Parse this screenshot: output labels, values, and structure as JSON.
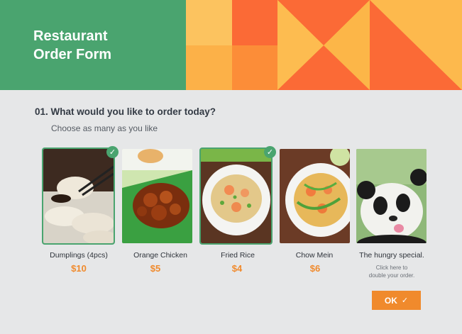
{
  "header": {
    "title": "Restaurant\nOrder Form"
  },
  "question": {
    "number_title": "01. What would you like to order today?",
    "subtitle": "Choose as many as you like"
  },
  "items": [
    {
      "name": "Dumplings (4pcs)",
      "price": "$10",
      "selected": true
    },
    {
      "name": "Orange Chicken",
      "price": "$5",
      "selected": false
    },
    {
      "name": "Fried Rice",
      "price": "$4",
      "selected": true
    },
    {
      "name": "Chow Mein",
      "price": "$6",
      "selected": false
    },
    {
      "name": "The hungry special.",
      "hint": "Click here to\ndouble your order.",
      "selected": false
    }
  ],
  "ok_button": {
    "label": "OK",
    "icon": "check-icon"
  },
  "colors": {
    "accent_green": "#4aa46f",
    "accent_orange": "#f08a2c",
    "background": "#e6e7e8"
  }
}
